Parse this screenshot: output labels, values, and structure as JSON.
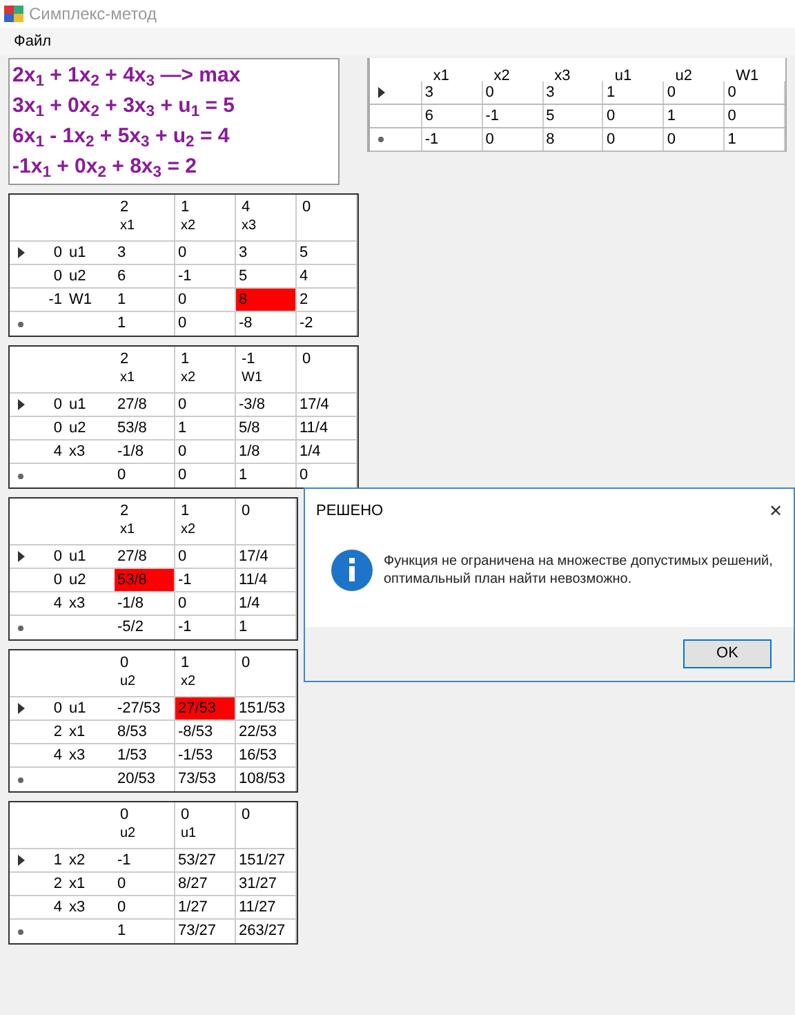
{
  "window": {
    "title": "Симплекс-метод"
  },
  "menu": [
    {
      "label": "Файл"
    }
  ],
  "equations": [
    "2x$_{1}$ + 1x$_{2}$ + 4x$_{3}$ —> max",
    "3x$_{1}$ + 0x$_{2}$ + 3x$_{3}$ + u$_{1}$ = 5",
    "6x$_{1}$ - 1x$_{2}$ + 5x$_{3}$ + u$_{2}$ = 4",
    "-1x$_{1}$ + 0x$_{2}$ + 8x$_{3}$ = 2"
  ],
  "matrix": {
    "columns": [
      "x1",
      "x2",
      "x3",
      "u1",
      "u2",
      "W1"
    ],
    "rows": [
      {
        "kind": "current",
        "cells": [
          "3",
          "0",
          "3",
          "1",
          "0",
          "0"
        ]
      },
      {
        "kind": "normal",
        "cells": [
          "6",
          "-1",
          "5",
          "0",
          "1",
          "0"
        ]
      },
      {
        "kind": "new",
        "cells": [
          "-1",
          "0",
          "8",
          "0",
          "0",
          "1"
        ]
      }
    ]
  },
  "tables": [
    {
      "columns": [
        {
          "coef": "2",
          "name": "x1"
        },
        {
          "coef": "1",
          "name": "x2"
        },
        {
          "coef": "4",
          "name": "x3"
        },
        {
          "coef": "0"
        }
      ],
      "rows": [
        {
          "kind": "current",
          "coef": "0",
          "basis": "u1",
          "cells": [
            {
              "text": "3",
              "highlighted": false
            },
            {
              "text": "0",
              "highlighted": false
            },
            {
              "text": "3",
              "highlighted": false
            },
            {
              "text": "5",
              "highlighted": false
            }
          ]
        },
        {
          "kind": "normal",
          "coef": "0",
          "basis": "u2",
          "cells": [
            {
              "text": "6",
              "highlighted": false
            },
            {
              "text": "-1",
              "highlighted": false
            },
            {
              "text": "5",
              "highlighted": false
            },
            {
              "text": "4",
              "highlighted": false
            }
          ]
        },
        {
          "kind": "normal",
          "coef": "-1",
          "basis": "W1",
          "cells": [
            {
              "text": "1",
              "highlighted": false
            },
            {
              "text": "0",
              "highlighted": false
            },
            {
              "text": "8",
              "highlighted": true
            },
            {
              "text": "2",
              "highlighted": false
            }
          ]
        },
        {
          "kind": "new",
          "cells": [
            {
              "text": "1",
              "highlighted": false
            },
            {
              "text": "0",
              "highlighted": false
            },
            {
              "text": "-8",
              "highlighted": false
            },
            {
              "text": "-2",
              "highlighted": false
            }
          ]
        }
      ]
    },
    {
      "columns": [
        {
          "coef": "2",
          "name": "x1"
        },
        {
          "coef": "1",
          "name": "x2"
        },
        {
          "coef": "-1",
          "name": "W1"
        },
        {
          "coef": "0"
        }
      ],
      "rows": [
        {
          "kind": "current",
          "coef": "0",
          "basis": "u1",
          "cells": [
            {
              "text": "27/8",
              "highlighted": false
            },
            {
              "text": "0",
              "highlighted": false
            },
            {
              "text": "-3/8",
              "highlighted": false
            },
            {
              "text": "17/4",
              "highlighted": false
            }
          ]
        },
        {
          "kind": "normal",
          "coef": "0",
          "basis": "u2",
          "cells": [
            {
              "text": "53/8",
              "highlighted": false
            },
            {
              "text": "1",
              "highlighted": false
            },
            {
              "text": "5/8",
              "highlighted": false
            },
            {
              "text": "11/4",
              "highlighted": false
            }
          ]
        },
        {
          "kind": "normal",
          "coef": "4",
          "basis": "x3",
          "cells": [
            {
              "text": "-1/8",
              "highlighted": false
            },
            {
              "text": "0",
              "highlighted": false
            },
            {
              "text": "1/8",
              "highlighted": false
            },
            {
              "text": "1/4",
              "highlighted": false
            }
          ]
        },
        {
          "kind": "new",
          "cells": [
            {
              "text": "0",
              "highlighted": false
            },
            {
              "text": "0",
              "highlighted": false
            },
            {
              "text": "1",
              "highlighted": false
            },
            {
              "text": "0",
              "highlighted": false
            }
          ]
        }
      ]
    },
    {
      "columns": [
        {
          "coef": "2",
          "name": "x1"
        },
        {
          "coef": "1",
          "name": "x2"
        },
        {
          "coef": "0"
        }
      ],
      "rows": [
        {
          "kind": "current",
          "coef": "0",
          "basis": "u1",
          "cells": [
            {
              "text": "27/8",
              "highlighted": false
            },
            {
              "text": "0",
              "highlighted": false
            },
            {
              "text": "17/4",
              "highlighted": false
            }
          ]
        },
        {
          "kind": "normal",
          "coef": "0",
          "basis": "u2",
          "cells": [
            {
              "text": "53/8",
              "highlighted": true
            },
            {
              "text": "-1",
              "highlighted": false
            },
            {
              "text": "11/4",
              "highlighted": false
            }
          ]
        },
        {
          "kind": "normal",
          "coef": "4",
          "basis": "x3",
          "cells": [
            {
              "text": "-1/8",
              "highlighted": false
            },
            {
              "text": "0",
              "highlighted": false
            },
            {
              "text": "1/4",
              "highlighted": false
            }
          ]
        },
        {
          "kind": "new",
          "cells": [
            {
              "text": "-5/2",
              "highlighted": false
            },
            {
              "text": "-1",
              "highlighted": false
            },
            {
              "text": "1",
              "highlighted": false
            }
          ]
        }
      ]
    },
    {
      "columns": [
        {
          "coef": "0",
          "name": "u2"
        },
        {
          "coef": "1",
          "name": "x2"
        },
        {
          "coef": "0"
        }
      ],
      "rows": [
        {
          "kind": "current",
          "coef": "0",
          "basis": "u1",
          "cells": [
            {
              "text": "-27/53",
              "highlighted": false
            },
            {
              "text": "27/53",
              "highlighted": true
            },
            {
              "text": "151/53",
              "highlighted": false
            }
          ]
        },
        {
          "kind": "normal",
          "coef": "2",
          "basis": "x1",
          "cells": [
            {
              "text": "8/53",
              "highlighted": false
            },
            {
              "text": "-8/53",
              "highlighted": false
            },
            {
              "text": "22/53",
              "highlighted": false
            }
          ]
        },
        {
          "kind": "normal",
          "coef": "4",
          "basis": "x3",
          "cells": [
            {
              "text": "1/53",
              "highlighted": false
            },
            {
              "text": "-1/53",
              "highlighted": false
            },
            {
              "text": "16/53",
              "highlighted": false
            }
          ]
        },
        {
          "kind": "new",
          "cells": [
            {
              "text": "20/53",
              "highlighted": false
            },
            {
              "text": "73/53",
              "highlighted": false
            },
            {
              "text": "108/53",
              "highlighted": false
            }
          ]
        }
      ]
    },
    {
      "columns": [
        {
          "coef": "0",
          "name": "u2"
        },
        {
          "coef": "0",
          "name": "u1"
        },
        {
          "coef": "0"
        }
      ],
      "rows": [
        {
          "kind": "current",
          "coef": "1",
          "basis": "x2",
          "cells": [
            {
              "text": "-1",
              "highlighted": false
            },
            {
              "text": "53/27",
              "highlighted": false
            },
            {
              "text": "151/27",
              "highlighted": false
            }
          ]
        },
        {
          "kind": "normal",
          "coef": "2",
          "basis": "x1",
          "cells": [
            {
              "text": "0",
              "highlighted": false
            },
            {
              "text": "8/27",
              "highlighted": false
            },
            {
              "text": "31/27",
              "highlighted": false
            }
          ]
        },
        {
          "kind": "normal",
          "coef": "4",
          "basis": "x3",
          "cells": [
            {
              "text": "0",
              "highlighted": false
            },
            {
              "text": "1/27",
              "highlighted": false
            },
            {
              "text": "11/27",
              "highlighted": false
            }
          ]
        },
        {
          "kind": "new",
          "cells": [
            {
              "text": "1",
              "highlighted": false
            },
            {
              "text": "73/27",
              "highlighted": false
            },
            {
              "text": "263/27",
              "highlighted": false
            }
          ]
        }
      ]
    }
  ],
  "dialog": {
    "title": "РЕШЕНО",
    "close": "✕",
    "message_lines": [
      "Функция не ограничена на множестве допустимых решений,",
      "оптимальный план найти невозможно."
    ],
    "button": "OK"
  }
}
